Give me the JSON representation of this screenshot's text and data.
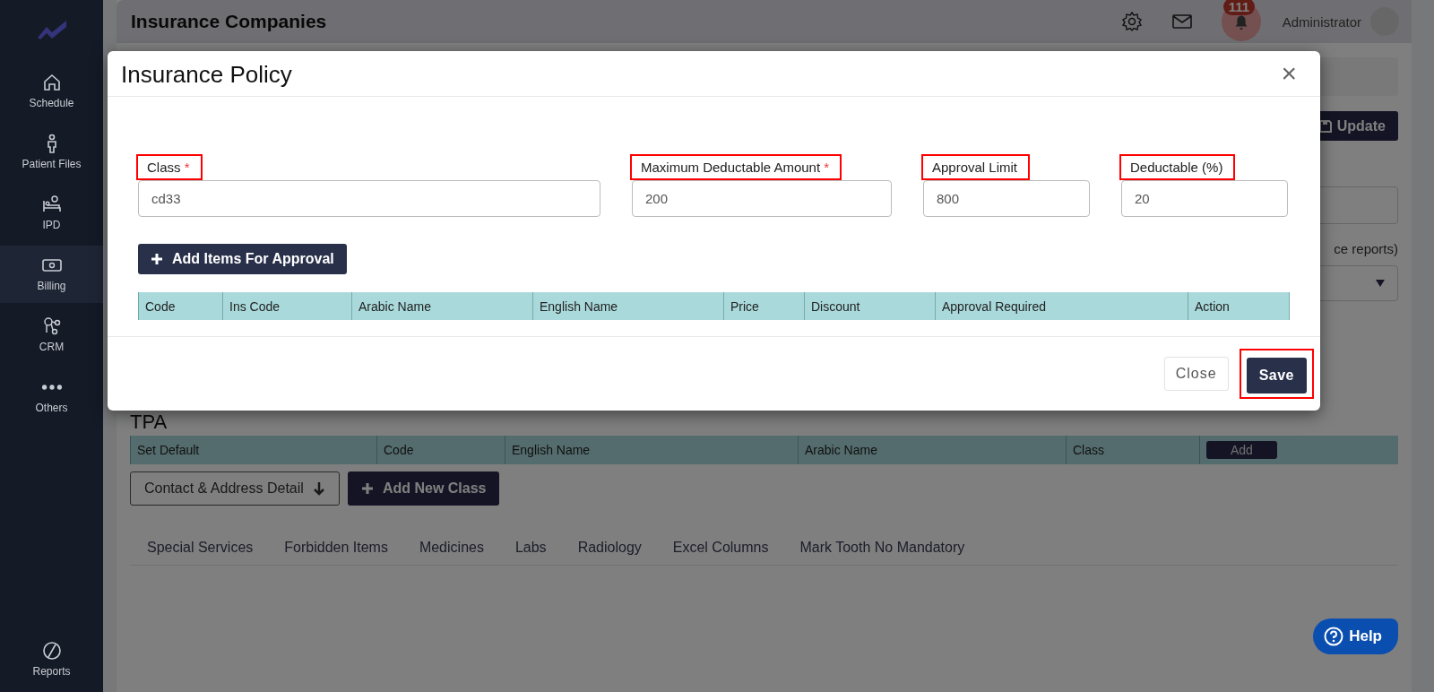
{
  "sidebar": {
    "items": [
      {
        "label": "Schedule",
        "selected": false
      },
      {
        "label": "Patient Files",
        "selected": false
      },
      {
        "label": "IPD",
        "selected": false
      },
      {
        "label": "Billing",
        "selected": true
      },
      {
        "label": "CRM",
        "selected": false
      },
      {
        "label": "Others",
        "selected": false
      }
    ],
    "bottom_item": {
      "label": "Reports"
    }
  },
  "header": {
    "title": "Insurance Companies",
    "notification_count": "111",
    "user": "Administrator"
  },
  "background": {
    "update_button": "Update",
    "partial_text": "ce reports)",
    "tpa": {
      "title": "TPA",
      "columns": [
        "Set Default",
        "Code",
        "English Name",
        "Arabic Name",
        "Class"
      ],
      "add_button": "Add"
    },
    "buttons": [
      {
        "label": "Contact & Address Detail",
        "kind": "outline"
      },
      {
        "label": "Add New Class",
        "kind": "primary"
      }
    ],
    "tabs": [
      "Special Services",
      "Forbidden Items",
      "Medicines",
      "Labs",
      "Radiology",
      "Excel Columns",
      "Mark Tooth No Mandatory"
    ],
    "help_button": "Help"
  },
  "modal": {
    "title": "Insurance Policy",
    "close_icon": "×",
    "fields": [
      {
        "label": "Class",
        "required_mark": "*",
        "value": "cd33",
        "highlighted": true
      },
      {
        "label": "Maximum Deductable Amount",
        "required_mark": "*",
        "value": "200",
        "highlighted": true
      },
      {
        "label": "Approval Limit",
        "value": "800",
        "highlighted": true
      },
      {
        "label": "Deductable (%)",
        "value": "20",
        "highlighted": true
      }
    ],
    "add_button": "Add Items For Approval",
    "table": {
      "columns": [
        "Code",
        "Ins Code",
        "Arabic Name",
        "English Name",
        "Price",
        "Discount",
        "Approval Required",
        "Action"
      ]
    },
    "footer": [
      {
        "label": "Close",
        "kind": "secondary"
      },
      {
        "label": "Save",
        "kind": "primary",
        "highlighted": true
      }
    ]
  }
}
